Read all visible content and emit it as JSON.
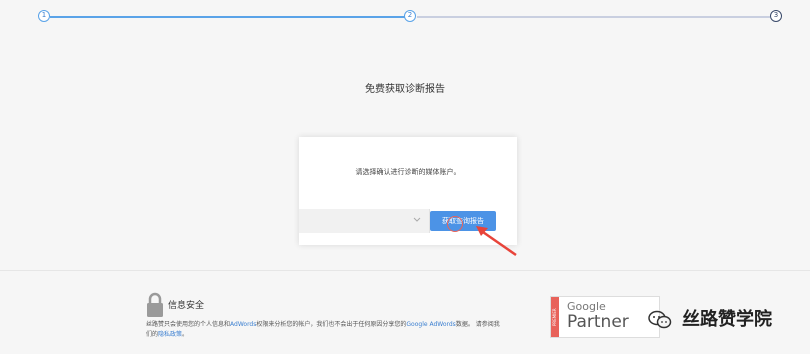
{
  "stepper": {
    "steps": [
      "1",
      "2",
      "3"
    ],
    "current_step": 2
  },
  "page": {
    "title": "免费获取诊断报告"
  },
  "card": {
    "prompt": "请选择确认进行诊断的媒体账户。",
    "button_label": "获取查询报告"
  },
  "security": {
    "title": "信息安全",
    "text_1": "丝路赞只会使用您的个人信息和",
    "link_adwords": "AdWords",
    "text_2": "权限来分析您的帐户，我们也不会出于任何原因分享您的",
    "link_google_adwords": "Google AdWords",
    "text_3": "数据。 请参阅我",
    "text_4": "们的",
    "link_privacy": "隐私政策",
    "text_5": "。"
  },
  "partner_badge": {
    "ribbon": "PREMIER",
    "brand": "Google",
    "label": "Partner"
  },
  "watermark": {
    "label": "丝路赞学院",
    "icon": "wechat-icon"
  },
  "colors": {
    "accent": "#4c93e6",
    "step_done": "#5aa3e8",
    "step_todo": "#c9cfe0",
    "pointer": "#e8443a"
  }
}
